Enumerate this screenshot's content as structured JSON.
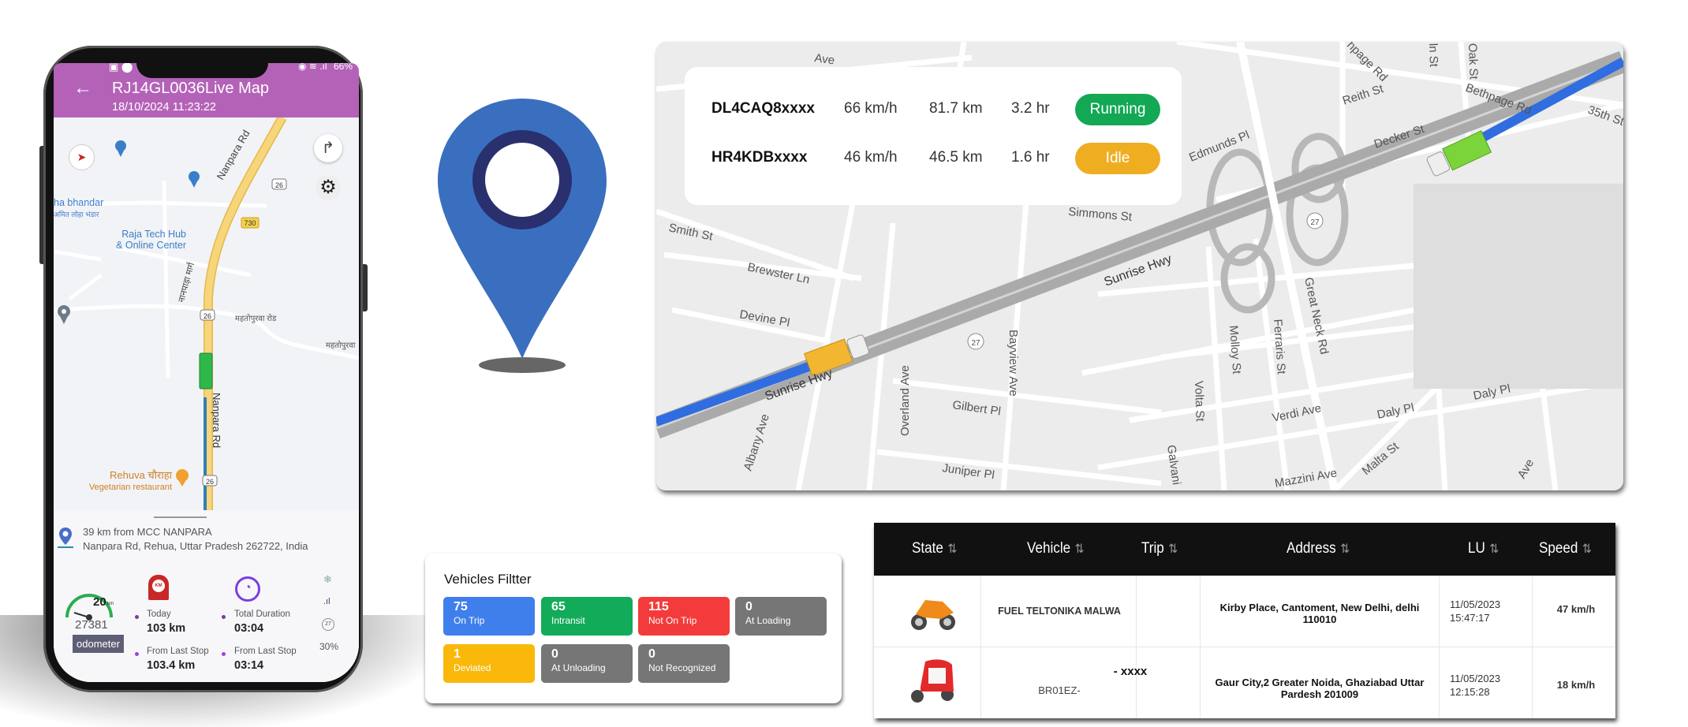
{
  "phone": {
    "status_bar": {
      "battery": "66%"
    },
    "header": {
      "title": "RJ14GL0036Live Map",
      "datetime": "18/10/2024 11:23:22"
    },
    "map_labels": {
      "road_name": "Nanpara Rd",
      "road_name_top": "Nanpara Rd",
      "shield_26": "26",
      "shield_730": "730",
      "hindi_road": "नानपाड़ा मार्ग",
      "mahsipurwa_road": "महतोपुरवा रोड",
      "mahsipurwa": "महतोपुरवा",
      "shop1_name": "ha bhandar",
      "shop1_hindi": "अमित लोहा भंडार",
      "shop2_line1": "Raja Tech Hub",
      "shop2_line2": "& Online Center",
      "restaurant_name": "Rehuva चौराहा",
      "restaurant_type": "Vegetarian restaurant"
    },
    "location": {
      "distance": "39 km from MCC NANPARA",
      "address": "Nanpara Rd, Rehua, Uttar Pradesh 262722, India"
    },
    "gauge": {
      "speed": "20",
      "unit": "km",
      "odometer_value": "27381",
      "odometer_label": "odometer"
    },
    "distance": {
      "icon_text": "KM",
      "today_label": "Today",
      "today_value": "103 km",
      "last_stop_label": "From Last Stop",
      "last_stop_value": "103.4 km"
    },
    "duration": {
      "total_label": "Total Duration",
      "total_value": "03:04",
      "last_stop_label": "From Last Stop",
      "last_stop_value": "03:14"
    },
    "side_status": {
      "temp_badge": "27",
      "battery": "30%"
    }
  },
  "pin_color": "#3a6fbf",
  "live_map": {
    "vehicles": [
      {
        "plate": "DL4CAQ8xxxx",
        "speed": "66 km/h",
        "distance": "81.7 km",
        "duration": "3.2 hr",
        "status": "Running",
        "status_color": "#12a854",
        "truck_color": "#7bd43a"
      },
      {
        "plate": "HR4KDBxxxx",
        "speed": "46 km/h",
        "distance": "46.5 km",
        "duration": "1.6 hr",
        "status": "Idle",
        "status_color": "#efad22",
        "truck_color": "#f2b630"
      }
    ],
    "streets": [
      "Smith St",
      "Brewster Ln",
      "Devine Pl",
      "Sunrise Hwy",
      "Sunrise Hwy",
      "Albany Ave",
      "Overland Ave",
      "Bayview Ave",
      "Gilbert Pl",
      "Juniper Pl",
      "Volta St",
      "Molloy St",
      "Ferraris St",
      "Great Neck Rd",
      "Verdi Ave",
      "Daly Pl",
      "Daly Pl",
      "Malta St",
      "Mazzini Ave",
      "Galvani",
      "Edmunds Pl",
      "Decker St",
      "Reith St",
      "Bethpage Rd",
      "Oak St",
      "35th St",
      "Simmons St",
      "Ave",
      "27",
      "27",
      "hpage Rd",
      "ln St",
      "Ave"
    ]
  },
  "vehicles_filter": {
    "title": "Vehicles Filtter",
    "tiles": [
      {
        "count": "75",
        "label": "On Trip",
        "color": "#3f7fec"
      },
      {
        "count": "65",
        "label": "Intransit",
        "color": "#12ab59"
      },
      {
        "count": "115",
        "label": "Not On Trip",
        "color": "#f43b3b"
      },
      {
        "count": "0",
        "label": "At Loading",
        "color": "#767676"
      },
      {
        "count": "1",
        "label": "Deviated",
        "color": "#f9b80a"
      },
      {
        "count": "0",
        "label": "At Unloading",
        "color": "#767676"
      },
      {
        "count": "0",
        "label": "Not Recognized",
        "color": "#767676"
      }
    ]
  },
  "table": {
    "columns": [
      "State",
      "Vehicle",
      "Trip",
      "Address",
      "LU",
      "Speed"
    ],
    "sort_glyph": "⇅",
    "rows": [
      {
        "state_icon": "motorcycle-icon",
        "vehicle": "FUEL TELTONIKA MALWA",
        "vehicle_suffix": "",
        "trip": "",
        "address": "Kirby  Place, Cantoment, New Delhi, delhi 110010",
        "lu_date": "11/05/2023",
        "lu_time": "15:47:17",
        "speed": "47 km/h"
      },
      {
        "state_icon": "rickshaw-icon",
        "vehicle": "BR01EZ-",
        "vehicle_suffix": "- xxxx",
        "trip": "",
        "address": "Gaur City,2 Greater Noida, Ghaziabad Uttar Pardesh 201009",
        "lu_date": "11/05/2023",
        "lu_time": "12:15:28",
        "speed": "18 km/h"
      }
    ]
  }
}
